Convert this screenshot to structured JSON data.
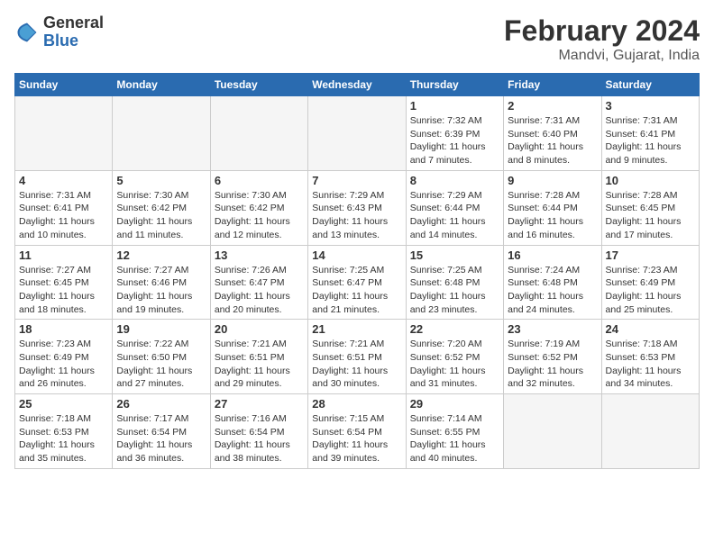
{
  "header": {
    "logo_line1": "General",
    "logo_line2": "Blue",
    "month": "February 2024",
    "location": "Mandvi, Gujarat, India"
  },
  "days_of_week": [
    "Sunday",
    "Monday",
    "Tuesday",
    "Wednesday",
    "Thursday",
    "Friday",
    "Saturday"
  ],
  "weeks": [
    [
      {
        "day": "",
        "empty": true
      },
      {
        "day": "",
        "empty": true
      },
      {
        "day": "",
        "empty": true
      },
      {
        "day": "",
        "empty": true
      },
      {
        "day": "1",
        "sunrise": "7:32 AM",
        "sunset": "6:39 PM",
        "daylight": "11 hours and 7 minutes."
      },
      {
        "day": "2",
        "sunrise": "7:31 AM",
        "sunset": "6:40 PM",
        "daylight": "11 hours and 8 minutes."
      },
      {
        "day": "3",
        "sunrise": "7:31 AM",
        "sunset": "6:41 PM",
        "daylight": "11 hours and 9 minutes."
      }
    ],
    [
      {
        "day": "4",
        "sunrise": "7:31 AM",
        "sunset": "6:41 PM",
        "daylight": "11 hours and 10 minutes."
      },
      {
        "day": "5",
        "sunrise": "7:30 AM",
        "sunset": "6:42 PM",
        "daylight": "11 hours and 11 minutes."
      },
      {
        "day": "6",
        "sunrise": "7:30 AM",
        "sunset": "6:42 PM",
        "daylight": "11 hours and 12 minutes."
      },
      {
        "day": "7",
        "sunrise": "7:29 AM",
        "sunset": "6:43 PM",
        "daylight": "11 hours and 13 minutes."
      },
      {
        "day": "8",
        "sunrise": "7:29 AM",
        "sunset": "6:44 PM",
        "daylight": "11 hours and 14 minutes."
      },
      {
        "day": "9",
        "sunrise": "7:28 AM",
        "sunset": "6:44 PM",
        "daylight": "11 hours and 16 minutes."
      },
      {
        "day": "10",
        "sunrise": "7:28 AM",
        "sunset": "6:45 PM",
        "daylight": "11 hours and 17 minutes."
      }
    ],
    [
      {
        "day": "11",
        "sunrise": "7:27 AM",
        "sunset": "6:45 PM",
        "daylight": "11 hours and 18 minutes."
      },
      {
        "day": "12",
        "sunrise": "7:27 AM",
        "sunset": "6:46 PM",
        "daylight": "11 hours and 19 minutes."
      },
      {
        "day": "13",
        "sunrise": "7:26 AM",
        "sunset": "6:47 PM",
        "daylight": "11 hours and 20 minutes."
      },
      {
        "day": "14",
        "sunrise": "7:25 AM",
        "sunset": "6:47 PM",
        "daylight": "11 hours and 21 minutes."
      },
      {
        "day": "15",
        "sunrise": "7:25 AM",
        "sunset": "6:48 PM",
        "daylight": "11 hours and 23 minutes."
      },
      {
        "day": "16",
        "sunrise": "7:24 AM",
        "sunset": "6:48 PM",
        "daylight": "11 hours and 24 minutes."
      },
      {
        "day": "17",
        "sunrise": "7:23 AM",
        "sunset": "6:49 PM",
        "daylight": "11 hours and 25 minutes."
      }
    ],
    [
      {
        "day": "18",
        "sunrise": "7:23 AM",
        "sunset": "6:49 PM",
        "daylight": "11 hours and 26 minutes."
      },
      {
        "day": "19",
        "sunrise": "7:22 AM",
        "sunset": "6:50 PM",
        "daylight": "11 hours and 27 minutes."
      },
      {
        "day": "20",
        "sunrise": "7:21 AM",
        "sunset": "6:51 PM",
        "daylight": "11 hours and 29 minutes."
      },
      {
        "day": "21",
        "sunrise": "7:21 AM",
        "sunset": "6:51 PM",
        "daylight": "11 hours and 30 minutes."
      },
      {
        "day": "22",
        "sunrise": "7:20 AM",
        "sunset": "6:52 PM",
        "daylight": "11 hours and 31 minutes."
      },
      {
        "day": "23",
        "sunrise": "7:19 AM",
        "sunset": "6:52 PM",
        "daylight": "11 hours and 32 minutes."
      },
      {
        "day": "24",
        "sunrise": "7:18 AM",
        "sunset": "6:53 PM",
        "daylight": "11 hours and 34 minutes."
      }
    ],
    [
      {
        "day": "25",
        "sunrise": "7:18 AM",
        "sunset": "6:53 PM",
        "daylight": "11 hours and 35 minutes."
      },
      {
        "day": "26",
        "sunrise": "7:17 AM",
        "sunset": "6:54 PM",
        "daylight": "11 hours and 36 minutes."
      },
      {
        "day": "27",
        "sunrise": "7:16 AM",
        "sunset": "6:54 PM",
        "daylight": "11 hours and 38 minutes."
      },
      {
        "day": "28",
        "sunrise": "7:15 AM",
        "sunset": "6:54 PM",
        "daylight": "11 hours and 39 minutes."
      },
      {
        "day": "29",
        "sunrise": "7:14 AM",
        "sunset": "6:55 PM",
        "daylight": "11 hours and 40 minutes."
      },
      {
        "day": "",
        "empty": true
      },
      {
        "day": "",
        "empty": true
      }
    ]
  ]
}
